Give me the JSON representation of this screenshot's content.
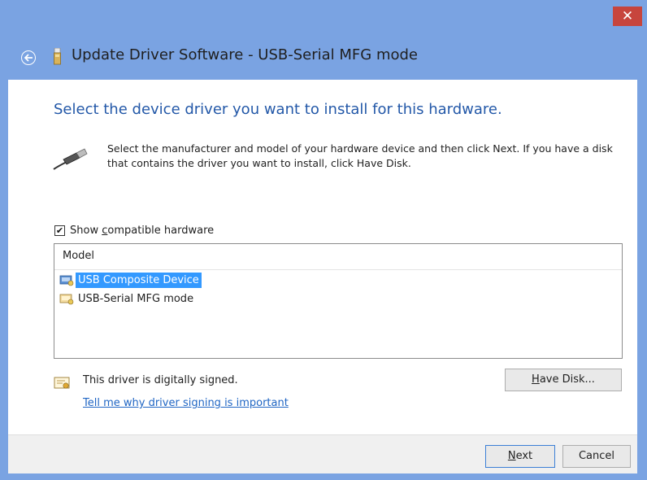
{
  "window": {
    "title": "Update Driver Software - USB-Serial MFG mode",
    "close_glyph": "✕",
    "back_glyph": "←"
  },
  "content": {
    "heading": "Select the device driver you want to install for this hardware.",
    "description": "Select the manufacturer and model of your hardware device and then click Next. If you have a disk that contains the driver you want to install, click Have Disk.",
    "show_compatible": {
      "checked": true,
      "check_glyph": "✔",
      "label_prefix": "Show ",
      "label_accel": "c",
      "label_rest": "ompatible hardware"
    },
    "model_list": {
      "header": "Model",
      "items": [
        {
          "label": "USB Composite Device",
          "selected": true
        },
        {
          "label": "USB-Serial MFG mode",
          "selected": false
        }
      ]
    },
    "signed_text": "This driver is digitally signed.",
    "signing_link": "Tell me why driver signing is important",
    "have_disk": {
      "accel": "H",
      "rest": "ave Disk..."
    }
  },
  "footer": {
    "next": {
      "accel": "N",
      "rest": "ext"
    },
    "cancel": "Cancel"
  },
  "colors": {
    "frame": "#7aa3e2",
    "close": "#c7453d",
    "heading": "#2358a8",
    "link": "#2066c4",
    "selection": "#3399ff"
  }
}
